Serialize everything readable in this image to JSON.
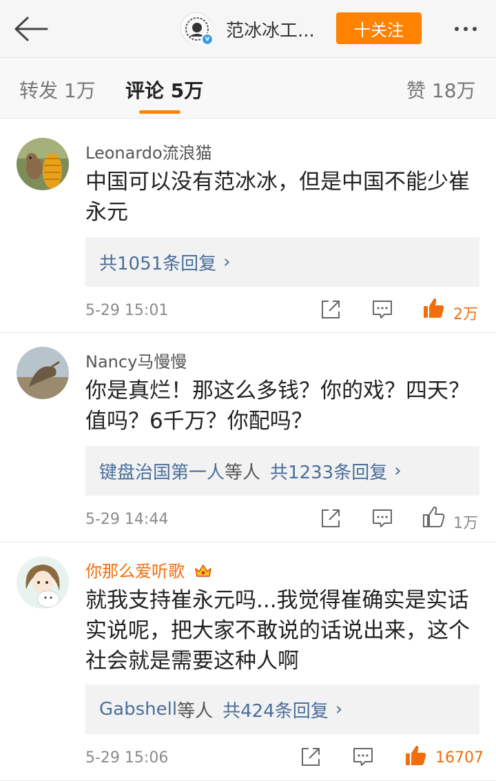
{
  "header": {
    "account_name": "范冰冰工...",
    "follow_label": "十关注",
    "verified_mark": "v"
  },
  "tabs": [
    {
      "label": "转发 1万"
    },
    {
      "label": "评论 5万"
    },
    {
      "label": "赞 18万"
    }
  ],
  "comments": [
    {
      "user": "Leonardo流浪猫",
      "text": "中国可以没有范冰冰，但是中国不能少崔永元",
      "reply_users": "",
      "reply_summary": "共1051条回复",
      "time": "5-29 15:01",
      "likes": "2万",
      "liked": true
    },
    {
      "user": "Nancy马慢慢",
      "text": "你是真烂！那这么多钱？你的戏？四天？值吗？6千万？你配吗？",
      "reply_users": "键盘治国第一人",
      "reply_sep": "等人",
      "reply_summary": "共1233条回复",
      "time": "5-29 14:44",
      "likes": "1万",
      "liked": false
    },
    {
      "user": "你那么爱听歌",
      "text": "就我支持崔永元吗...我觉得崔确实是实话实说呢，把大家不敢说的话说出来，这个社会就是需要这种人啊",
      "reply_users": "Gabshell",
      "reply_sep": "等人",
      "reply_summary": "共424条回复",
      "time": "5-29 15:06",
      "likes": "16707",
      "liked": true
    }
  ],
  "colors": {
    "accent": "#ff8200",
    "link": "#4a6e9a",
    "vip_name": "#f26d0b"
  }
}
